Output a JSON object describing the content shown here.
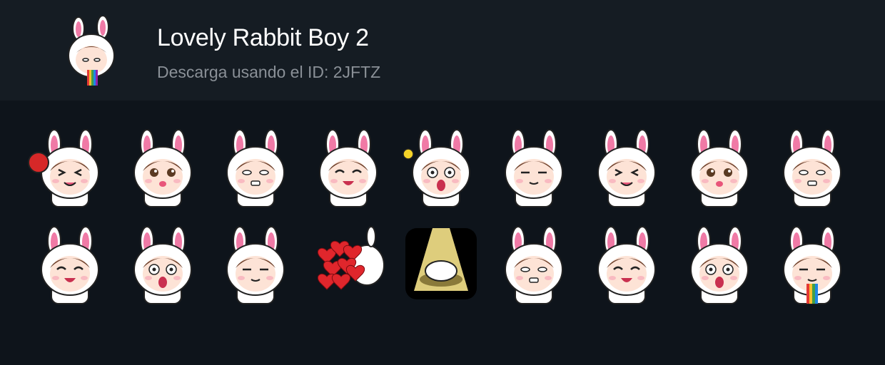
{
  "header": {
    "title": "Lovely Rabbit Boy 2",
    "subtitle": "Descarga usando el ID: 2JFTZ"
  },
  "colors": {
    "background": "#0e141b",
    "header_background": "#151c23",
    "ear_inner": "#f07aa6",
    "hood": "#ffffff",
    "hair": "#6b3f2a",
    "skin": "#fde3d6"
  },
  "stickers": [
    {
      "icon": "boxing-glove-punch-icon"
    },
    {
      "icon": "happy-sparkle-eyes-icon"
    },
    {
      "icon": "wind-blown-icon"
    },
    {
      "icon": "back-view-icon"
    },
    {
      "icon": "lightbulb-idea-icon"
    },
    {
      "icon": "squint-smile-icon"
    },
    {
      "icon": "shouting-icon"
    },
    {
      "icon": "smug-glint-icon"
    },
    {
      "icon": "sly-grin-icon"
    },
    {
      "icon": "puzzled-pout-icon"
    },
    {
      "icon": "sighing-sweat-icon"
    },
    {
      "icon": "hit-by-shoe-icon"
    },
    {
      "icon": "heart-bouquet-icon"
    },
    {
      "icon": "spotlight-bow-icon"
    },
    {
      "icon": "giggle-icon"
    },
    {
      "icon": "shocked-icon"
    },
    {
      "icon": "laughing-icon"
    },
    {
      "icon": "rainbow-vomit-icon"
    }
  ]
}
